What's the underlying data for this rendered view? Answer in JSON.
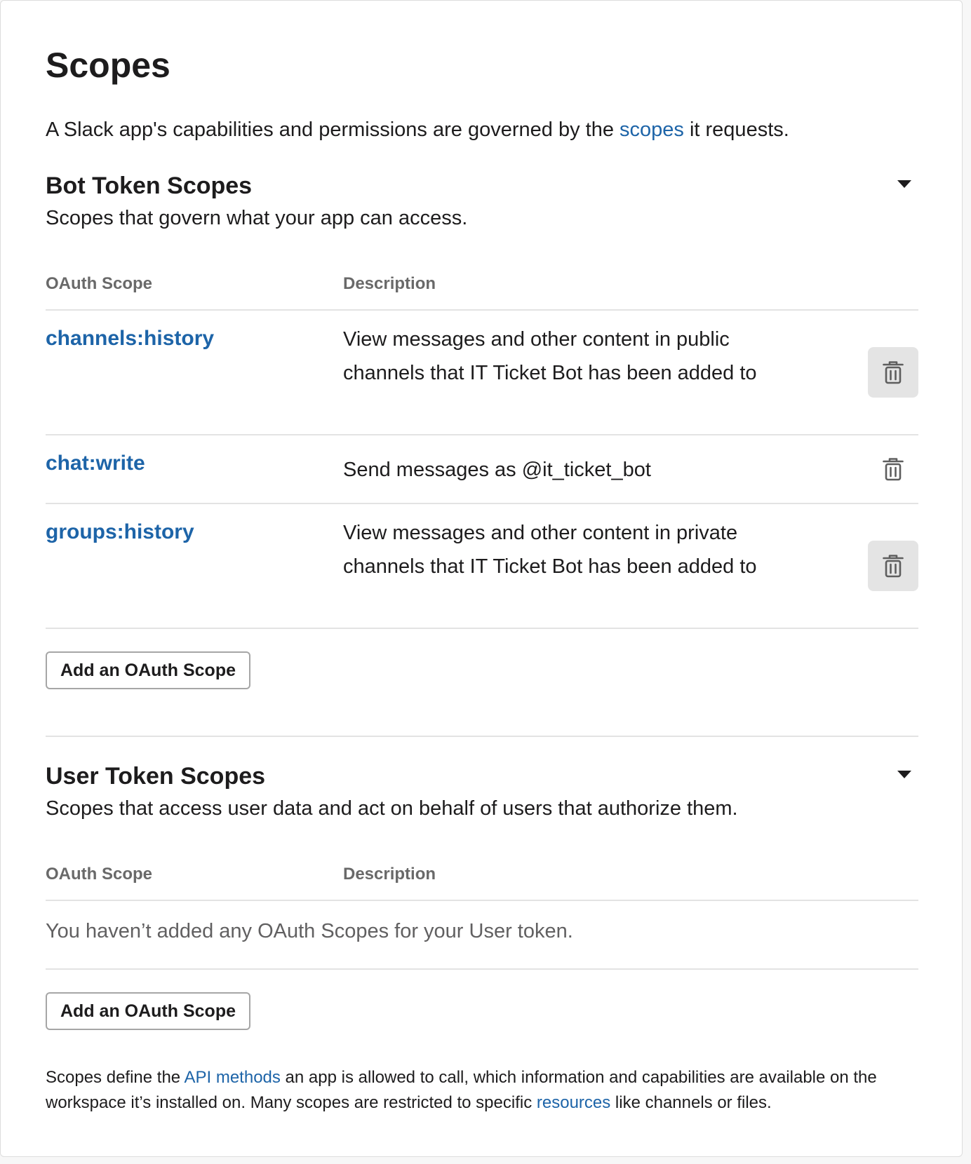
{
  "page": {
    "title": "Scopes",
    "intro_before": "A Slack app's capabilities and permissions are governed by the ",
    "intro_link": "scopes",
    "intro_after": " it requests."
  },
  "bot": {
    "title": "Bot Token Scopes",
    "subtitle": "Scopes that govern what your app can access.",
    "col_scope": "OAuth Scope",
    "col_desc": "Description",
    "scopes": [
      {
        "name": "channels:history",
        "desc": "View messages and other content in public channels that IT Ticket Bot has been added to"
      },
      {
        "name": "chat:write",
        "desc": "Send messages as @it_ticket_bot"
      },
      {
        "name": "groups:history",
        "desc": "View messages and other content in private channels that IT Ticket Bot has been added to"
      }
    ],
    "add_label": "Add an OAuth Scope"
  },
  "user": {
    "title": "User Token Scopes",
    "subtitle": "Scopes that access user data and act on behalf of users that authorize them.",
    "col_scope": "OAuth Scope",
    "col_desc": "Description",
    "empty": "You haven’t added any OAuth Scopes for your User token.",
    "add_label": "Add an OAuth Scope"
  },
  "footer": {
    "before": "Scopes define the ",
    "link1": "API methods",
    "middle": " an app is allowed to call, which information and capabilities are available on the workspace it’s installed on. Many scopes are restricted to specific ",
    "link2": "resources",
    "after": " like channels or files."
  },
  "icons": {
    "delete": "trash-icon",
    "collapse": "caret-down-icon"
  },
  "colors": {
    "link": "#1d64a8",
    "text": "#1d1c1d",
    "muted": "#696969"
  }
}
